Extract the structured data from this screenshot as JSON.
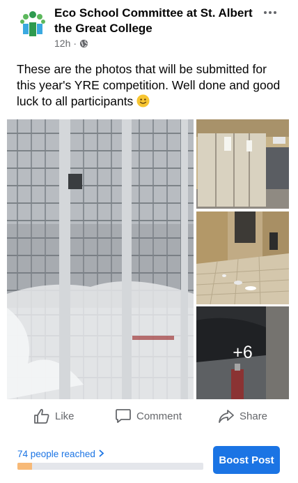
{
  "post": {
    "page_name": "Eco School Committee at St. Albert the Great College",
    "time": "12h",
    "separator": "·",
    "audience_icon": "globe-icon",
    "more_icon": "more-options-icon",
    "text": "These are the photos that will be submitted for this year's YRE competition. Well done and good luck to all participants",
    "emoji": "smiling-face-emoji"
  },
  "photos": {
    "more_count": "+6"
  },
  "actions": {
    "like_label": "Like",
    "comment_label": "Comment",
    "share_label": "Share"
  },
  "insights": {
    "reach_label": "74 people reached",
    "reach_progress_fraction": 0.08,
    "boost_label": "Boost Post"
  },
  "colors": {
    "accent": "#1b74e4",
    "secondary_text": "#65676b",
    "progress_fill": "#f7b977"
  }
}
